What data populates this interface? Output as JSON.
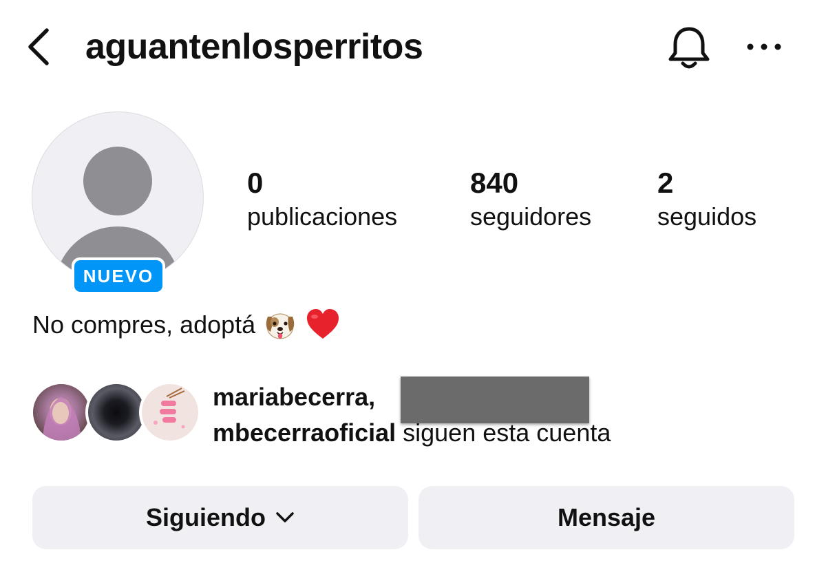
{
  "header": {
    "username": "aguantenlosperritos",
    "back_icon": "chevron-left-icon",
    "notifications_icon": "bell-icon",
    "more_icon": "more-horizontal-icon"
  },
  "profile": {
    "avatar_icon": "default-avatar-icon",
    "new_badge": "NUEVO",
    "stats": [
      {
        "value": "0",
        "label": "publicaciones"
      },
      {
        "value": "840",
        "label": "seguidores"
      },
      {
        "value": "2",
        "label": "seguidos"
      }
    ],
    "bio_text": "No compres, adoptá",
    "bio_emojis": [
      "dog-face-icon",
      "red-heart-icon"
    ]
  },
  "followed_by": {
    "first": "mariabecerra,",
    "second": "mbecerraoficial",
    "suffix": " siguen esta cuenta"
  },
  "actions": {
    "following_label": "Siguiendo",
    "message_label": "Mensaje"
  },
  "colors": {
    "badge_blue": "#0095f6",
    "button_bg": "#efeff4",
    "avatar_bg": "#efeff4",
    "avatar_figure": "#8e8e93"
  }
}
